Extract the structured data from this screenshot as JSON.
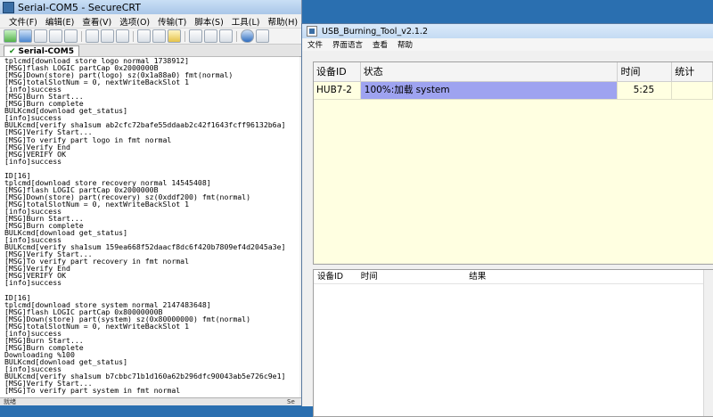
{
  "crt": {
    "title": "Serial-COM5 - SecureCRT",
    "menu": [
      "文件(F)",
      "编辑(E)",
      "查看(V)",
      "选项(O)",
      "传输(T)",
      "脚本(S)",
      "工具(L)",
      "帮助(H)"
    ],
    "tab_label": "Serial-COM5",
    "terminal_lines": [
      "tplcmd[download store logo normal 1738912]",
      "[MSG]flash LOGIC partCap 0x2000000B",
      "[MSG]Down(store) part(logo) sz(0x1a88a0) fmt(normal)",
      "[MSG]totalSlotNum = 0, nextWriteBackSlot 1",
      "[info]success",
      "[MSG]Burn Start...",
      "[MSG]Burn complete",
      "BULKcmd[download get_status]",
      "[info]success",
      "BULKcmd[verify sha1sum ab2cfc72bafe55ddaab2c42f1643fcff96132b6a]",
      "[MSG]Verify Start...",
      "[MSG]To verify part logo in fmt normal",
      "[MSG]Verify End",
      "[MSG]VERIFY OK",
      "[info]success",
      "",
      "ID[16]",
      "tplcmd[download store recovery normal 14545408]",
      "[MSG]flash LOGIC partCap 0x2000000B",
      "[MSG]Down(store) part(recovery) sz(0xddf200) fmt(normal)",
      "[MSG]totalSlotNum = 0, nextWriteBackSlot 1",
      "[info]success",
      "[MSG]Burn Start...",
      "[MSG]Burn complete",
      "BULKcmd[download get_status]",
      "[info]success",
      "BULKcmd[verify sha1sum 159ea668f52daacf8dc6f420b7809ef4d2045a3e]",
      "[MSG]Verify Start...",
      "[MSG]To verify part recovery in fmt normal",
      "[MSG]Verify End",
      "[MSG]VERIFY OK",
      "[info]success",
      "",
      "ID[16]",
      "tplcmd[download store system normal 2147483648]",
      "[MSG]flash LOGIC partCap 0x80000000B",
      "[MSG]Down(store) part(system) sz(0x80000000) fmt(normal)",
      "[MSG]totalSlotNum = 0, nextWriteBackSlot 1",
      "[info]success",
      "[MSG]Burn Start...",
      "[MSG]Burn complete",
      "Downloading %100",
      "BULKcmd[download get_status]",
      "[info]success",
      "BULKcmd[verify sha1sum b7cbbc71b1d160a62b296dfc90043ab5e726c9e1]",
      "[MSG]Verify Start...",
      "[MSG]To verify part system in fmt normal"
    ],
    "status_left": "就绪",
    "status_right": "Se"
  },
  "ubt": {
    "title": "USB_Burning_Tool_v2.1.2",
    "menu": [
      "文件",
      "界面语言",
      "查看",
      "帮助"
    ],
    "upper_headers": [
      "设备ID",
      "状态",
      "时间",
      "统计"
    ],
    "device_row": {
      "id": "HUB7-2",
      "status": "100%:加载 system",
      "time": "5:25",
      "stat": ""
    },
    "lower_headers": [
      "设备ID",
      "时间",
      "结果"
    ]
  },
  "colors": {
    "progress_fill": "#9ea3f0",
    "upper_bg": "#ffffe1",
    "desktop": "#2a6fb0"
  }
}
